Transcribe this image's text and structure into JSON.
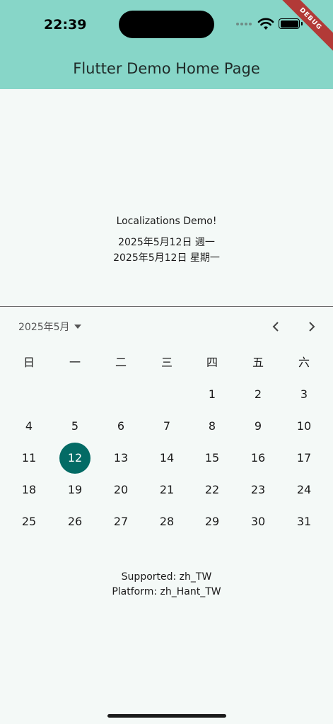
{
  "status_bar": {
    "time": "22:39"
  },
  "debug_banner": {
    "label": "DEBUG"
  },
  "app_bar": {
    "title": "Flutter Demo Home Page"
  },
  "demo": {
    "heading": "Localizations Demo!",
    "date_short_weekday": "2025年5月12日 週一",
    "date_long_weekday": "2025年5月12日 星期一"
  },
  "calendar": {
    "month_label": "2025年5月",
    "weekdays": [
      "日",
      "一",
      "二",
      "三",
      "四",
      "五",
      "六"
    ],
    "first_weekday_index": 4,
    "days_in_month": 31,
    "selected_day": "12"
  },
  "info": {
    "supported": "Supported: zh_TW",
    "platform": "Platform: zh_Hant_TW"
  },
  "colors": {
    "app_bar": "#87d6c8",
    "selected_day": "#036b65",
    "background": "#f4f9f7"
  },
  "icons": [
    "wifi-icon",
    "battery-icon",
    "dropdown-caret-icon",
    "chevron-left-icon",
    "chevron-right-icon"
  ]
}
